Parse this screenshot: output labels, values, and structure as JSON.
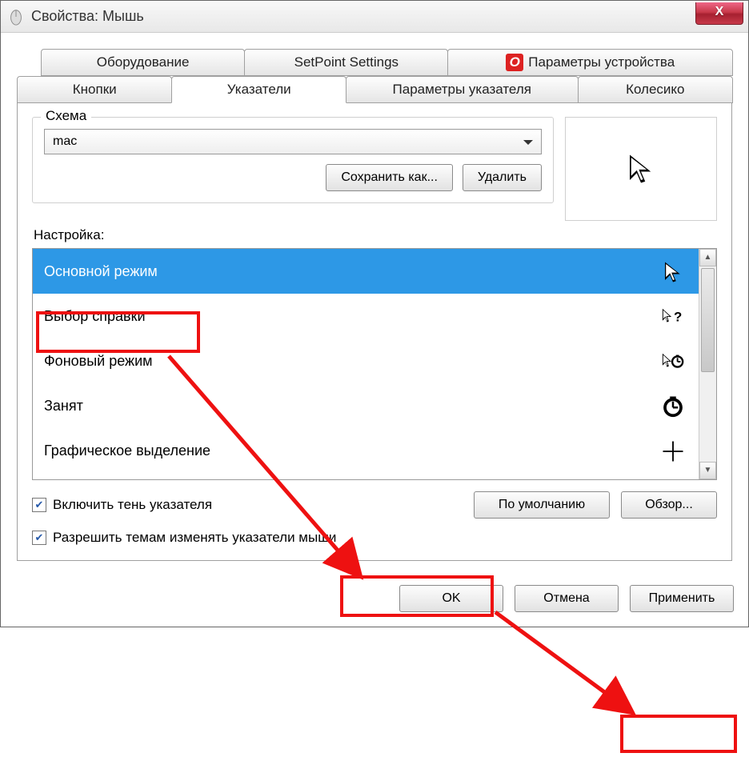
{
  "titlebar": {
    "title": "Свойства: Мышь",
    "close": "X"
  },
  "tabs_top": [
    {
      "label": "Оборудование"
    },
    {
      "label": "SetPoint Settings"
    },
    {
      "label": "Параметры устройства"
    }
  ],
  "tabs_bottom": [
    {
      "label": "Кнопки"
    },
    {
      "label": "Указатели"
    },
    {
      "label": "Параметры указателя"
    },
    {
      "label": "Колесико"
    }
  ],
  "scheme": {
    "group_label": "Схема",
    "selected": "mac",
    "save_as": "Сохранить как...",
    "delete": "Удалить"
  },
  "customize": {
    "label": "Настройка:",
    "items": [
      {
        "label": "Основной режим",
        "icon": "cursor-arrow",
        "selected": true
      },
      {
        "label": "Выбор справки",
        "icon": "cursor-help"
      },
      {
        "label": "Фоновый режим",
        "icon": "cursor-working"
      },
      {
        "label": "Занят",
        "icon": "cursor-busy"
      },
      {
        "label": "Графическое выделение",
        "icon": "cursor-precision"
      }
    ]
  },
  "options": {
    "shadow": "Включить тень указателя",
    "themes": "Разрешить темам изменять указатели мыши",
    "default_btn": "По умолчанию",
    "browse_btn": "Обзор..."
  },
  "footer": {
    "ok": "OK",
    "cancel": "Отмена",
    "apply": "Применить"
  }
}
